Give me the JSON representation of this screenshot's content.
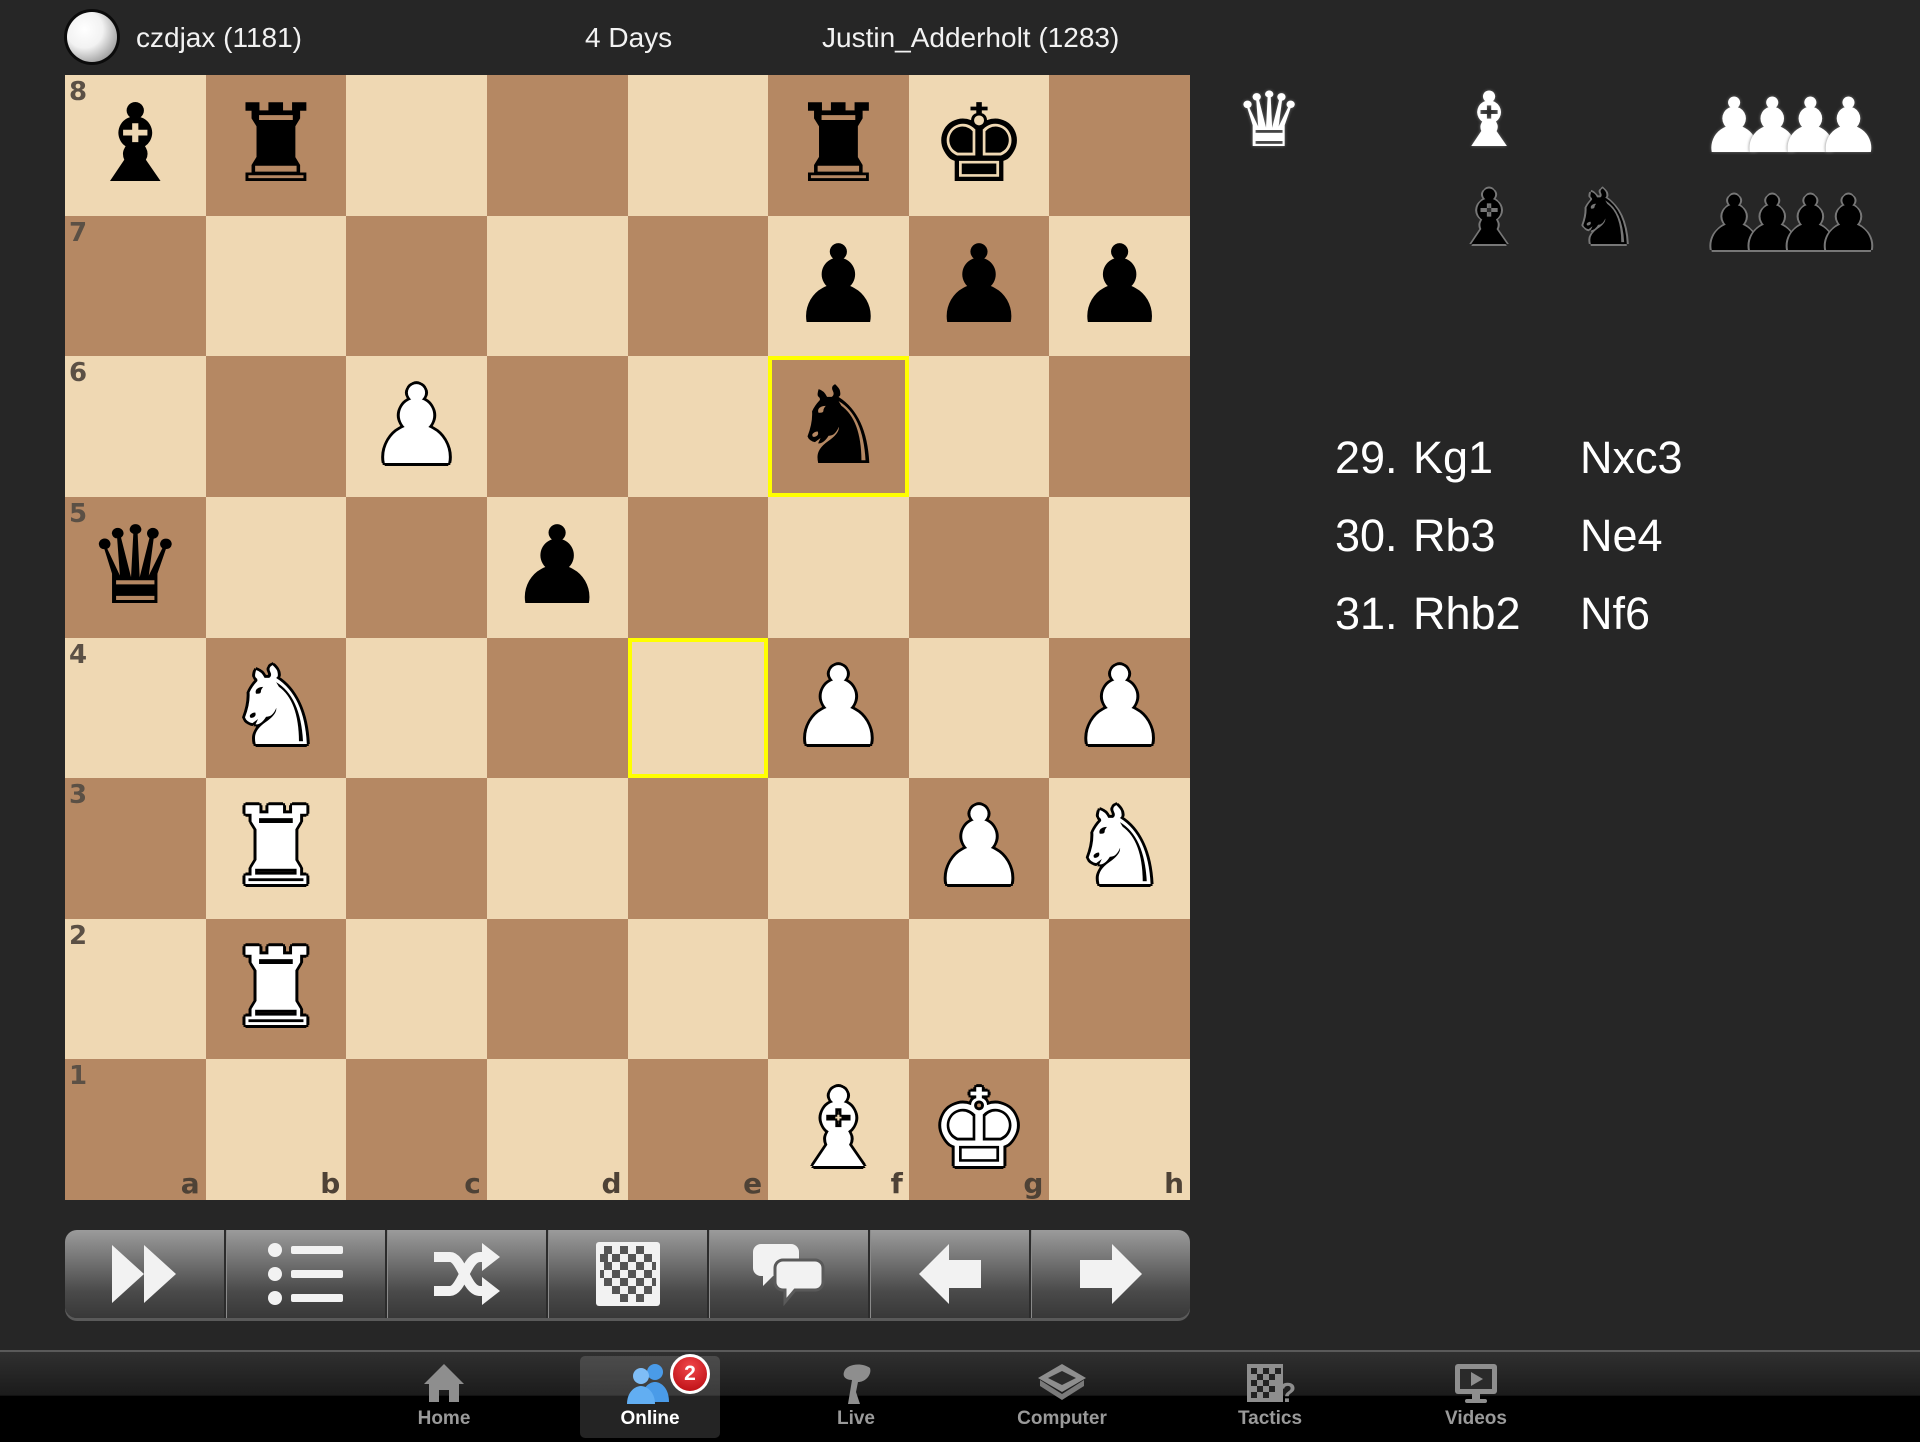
{
  "header": {
    "turn_indicator": "white-to-move",
    "white_player": "czdjax (1181)",
    "time_control": "4 Days",
    "black_player": "Justin_Adderholt (1283)"
  },
  "board": {
    "orientation": "white-bottom",
    "ranks": [
      "8",
      "7",
      "6",
      "5",
      "4",
      "3",
      "2",
      "1"
    ],
    "files": [
      "a",
      "b",
      "c",
      "d",
      "e",
      "f",
      "g",
      "h"
    ],
    "light_color": "#efd8b3",
    "dark_color": "#b58863",
    "highlight_color": "#ffff00",
    "highlighted_squares": [
      "f6",
      "e4"
    ],
    "pieces": {
      "a8": "bB",
      "b8": "bR",
      "f8": "bR",
      "g8": "bK",
      "f7": "bP",
      "g7": "bP",
      "h7": "bP",
      "c6": "wP",
      "f6": "bN",
      "a5": "bQ",
      "d5": "bP",
      "b4": "wN",
      "f4": "wP",
      "h4": "wP",
      "b3": "wR",
      "g3": "wP",
      "h3": "wN",
      "b2": "wR",
      "f1": "wB",
      "g1": "wK"
    }
  },
  "captured": {
    "white": [
      "queen",
      "bishop",
      "pawn",
      "pawn",
      "pawn",
      "pawn"
    ],
    "black": [
      "bishop",
      "knight",
      "pawn",
      "pawn",
      "pawn",
      "pawn"
    ]
  },
  "glyphs": {
    "K": "♚",
    "Q": "♛",
    "R": "♜",
    "B": "♝",
    "N": "♞",
    "P": "♟"
  },
  "moves": [
    {
      "number": "29.",
      "white": "Kg1",
      "black": "Nxc3"
    },
    {
      "number": "30.",
      "white": "Rb3",
      "black": "Ne4"
    },
    {
      "number": "31.",
      "white": "Rhb2",
      "black": "Nf6"
    }
  ],
  "toolbar": [
    {
      "name": "fast-forward",
      "icon": "fast-forward-icon"
    },
    {
      "name": "move-list",
      "icon": "list-icon"
    },
    {
      "name": "flip-board",
      "icon": "shuffle-icon"
    },
    {
      "name": "board-view",
      "icon": "checkerboard-icon"
    },
    {
      "name": "chat",
      "icon": "chat-bubbles-icon"
    },
    {
      "name": "previous-move",
      "icon": "arrow-left-icon"
    },
    {
      "name": "next-move",
      "icon": "arrow-right-icon"
    }
  ],
  "tabbar": {
    "active": "Online",
    "tabs": [
      {
        "label": "Home",
        "icon": "home-icon"
      },
      {
        "label": "Online",
        "icon": "users-icon",
        "badge": "2"
      },
      {
        "label": "Live",
        "icon": "live-knight-icon"
      },
      {
        "label": "Computer",
        "icon": "chip-icon"
      },
      {
        "label": "Tactics",
        "icon": "tactics-icon"
      },
      {
        "label": "Videos",
        "icon": "video-icon"
      }
    ]
  }
}
